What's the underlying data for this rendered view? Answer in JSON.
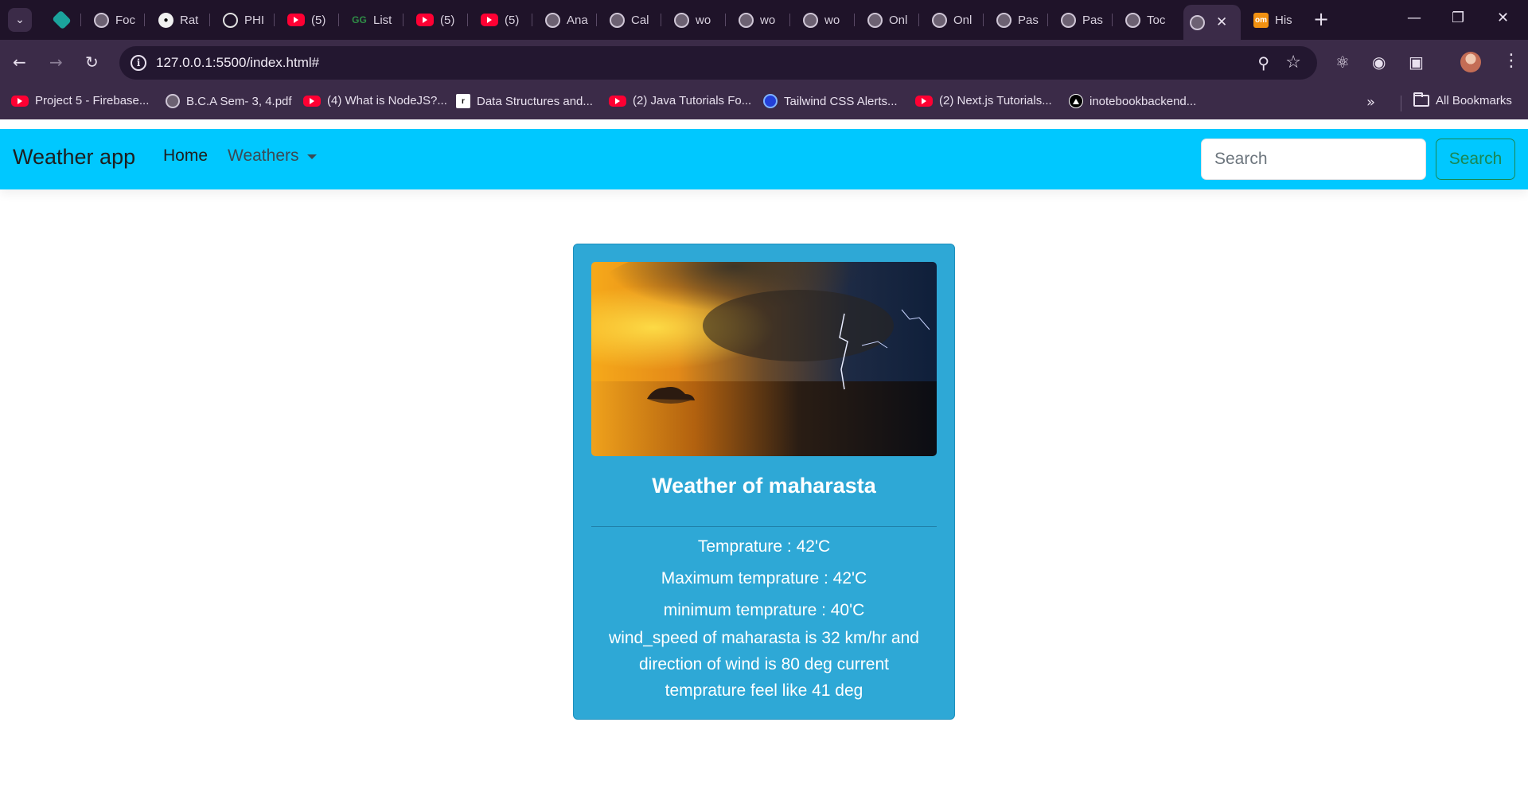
{
  "browser": {
    "tabs": [
      {
        "label": "",
        "icon": "diamond-icon"
      },
      {
        "label": "Foc",
        "icon": "globe-icon"
      },
      {
        "label": "Rat",
        "icon": "github-icon"
      },
      {
        "label": "PHI",
        "icon": "openai-icon"
      },
      {
        "label": "(5) ",
        "icon": "youtube-icon"
      },
      {
        "label": "List",
        "icon": "gfg-icon"
      },
      {
        "label": "(5)",
        "icon": "youtube-icon"
      },
      {
        "label": "(5) ",
        "icon": "youtube-icon"
      },
      {
        "label": "Ana",
        "icon": "globe-icon"
      },
      {
        "label": "Cal",
        "icon": "globe-icon"
      },
      {
        "label": "wo",
        "icon": "globe-icon"
      },
      {
        "label": "wo",
        "icon": "globe-icon"
      },
      {
        "label": "wo",
        "icon": "globe-icon"
      },
      {
        "label": "Onl",
        "icon": "globe-icon"
      },
      {
        "label": "Onl",
        "icon": "globe-icon"
      },
      {
        "label": "Pas",
        "icon": "globe-icon"
      },
      {
        "label": "Pas",
        "icon": "globe-icon"
      },
      {
        "label": "Toc",
        "icon": "globe-icon"
      },
      {
        "label": "",
        "icon": "globe-icon",
        "active": true
      },
      {
        "label": "His",
        "icon": "om-icon"
      }
    ],
    "url": "127.0.0.1:5500/index.html#",
    "bookmarks": [
      {
        "label": "Project 5 - Firebase...",
        "icon": "youtube-icon"
      },
      {
        "label": "B.C.A Sem- 3, 4.pdf",
        "icon": "globe-icon"
      },
      {
        "label": "(4) What is NodeJS?...",
        "icon": "youtube-icon"
      },
      {
        "label": "Data Structures and...",
        "icon": "ds-icon"
      },
      {
        "label": "(2) Java Tutorials Fo...",
        "icon": "youtube-icon"
      },
      {
        "label": "Tailwind CSS Alerts...",
        "icon": "tailwind-icon"
      },
      {
        "label": "(2) Next.js Tutorials...",
        "icon": "youtube-icon"
      },
      {
        "label": "inotebookbackend...",
        "icon": "vercel-icon"
      }
    ],
    "all_bookmarks_label": "All Bookmarks"
  },
  "navbar": {
    "brand": "Weather app",
    "home": "Home",
    "weathers": "Weathers",
    "search_placeholder": "Search",
    "search_button": "Search",
    "bg_color": "#00c8ff"
  },
  "card": {
    "title": "Weather of maharasta",
    "temp_line": "Temprature : 42'C",
    "max_line": "Maximum temprature : 42'C",
    "min_line": "minimum temprature : 40'C",
    "wind_text": "wind_speed of maharasta is 32 km/hr and direction of wind is 80 deg current temprature feel like 41 deg",
    "bg_color": "#2ea8d6"
  }
}
